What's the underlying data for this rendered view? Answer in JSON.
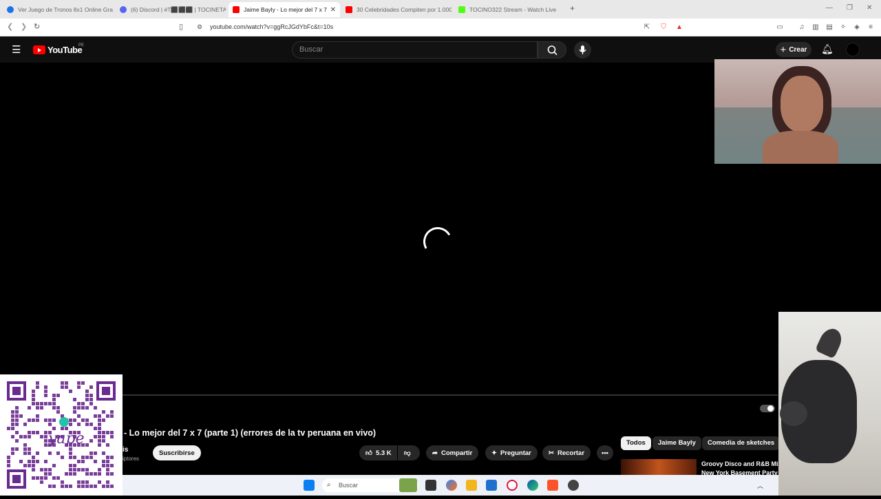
{
  "browser": {
    "tabs": [
      {
        "label": "Ver Juego de Tronos 8x1 Online Gra",
        "favicon_color": "#1a73e8"
      },
      {
        "label": "(6) Discord | #T⬛⬛⬛ | TOCINETA",
        "favicon_color": "#5865f2"
      },
      {
        "label": "Jaime Bayly - Lo mejor del 7 x 7",
        "favicon_color": "#ff0000"
      },
      {
        "label": "30 Celebridades Compiten por 1.000",
        "favicon_color": "#ff0000"
      },
      {
        "label": "TOCINO322 Stream - Watch Live",
        "favicon_color": "#53fc18"
      }
    ],
    "new_tab": "+",
    "url": "youtube.com/watch?v=ggRcJGdYbFc&t=10s"
  },
  "youtube": {
    "logo_text": "YouTube",
    "region": "PE",
    "search_placeholder": "Buscar",
    "create_label": "Crear",
    "video_title": "- Lo mejor del 7 x 7 (parte 1) (errores de la tv peruana en vivo)",
    "channel_fragment": "is",
    "subscribers_fragment": "iptores",
    "subscribe_label": "Suscribirse",
    "likes": "5.3 K",
    "share_label": "Compartir",
    "ask_label": "Preguntar",
    "clip_label": "Recortar",
    "chips": [
      "Todos",
      "Jaime Bayly",
      "Comedia de sketches"
    ],
    "related_title_1": "Groovy Disco and R&B Mix",
    "related_title_2": "New York Basement Party"
  },
  "taskbar": {
    "search_placeholder": "Buscar"
  },
  "colors": {
    "yt_red": "#ff0000",
    "bg": "#0f0f0f"
  }
}
